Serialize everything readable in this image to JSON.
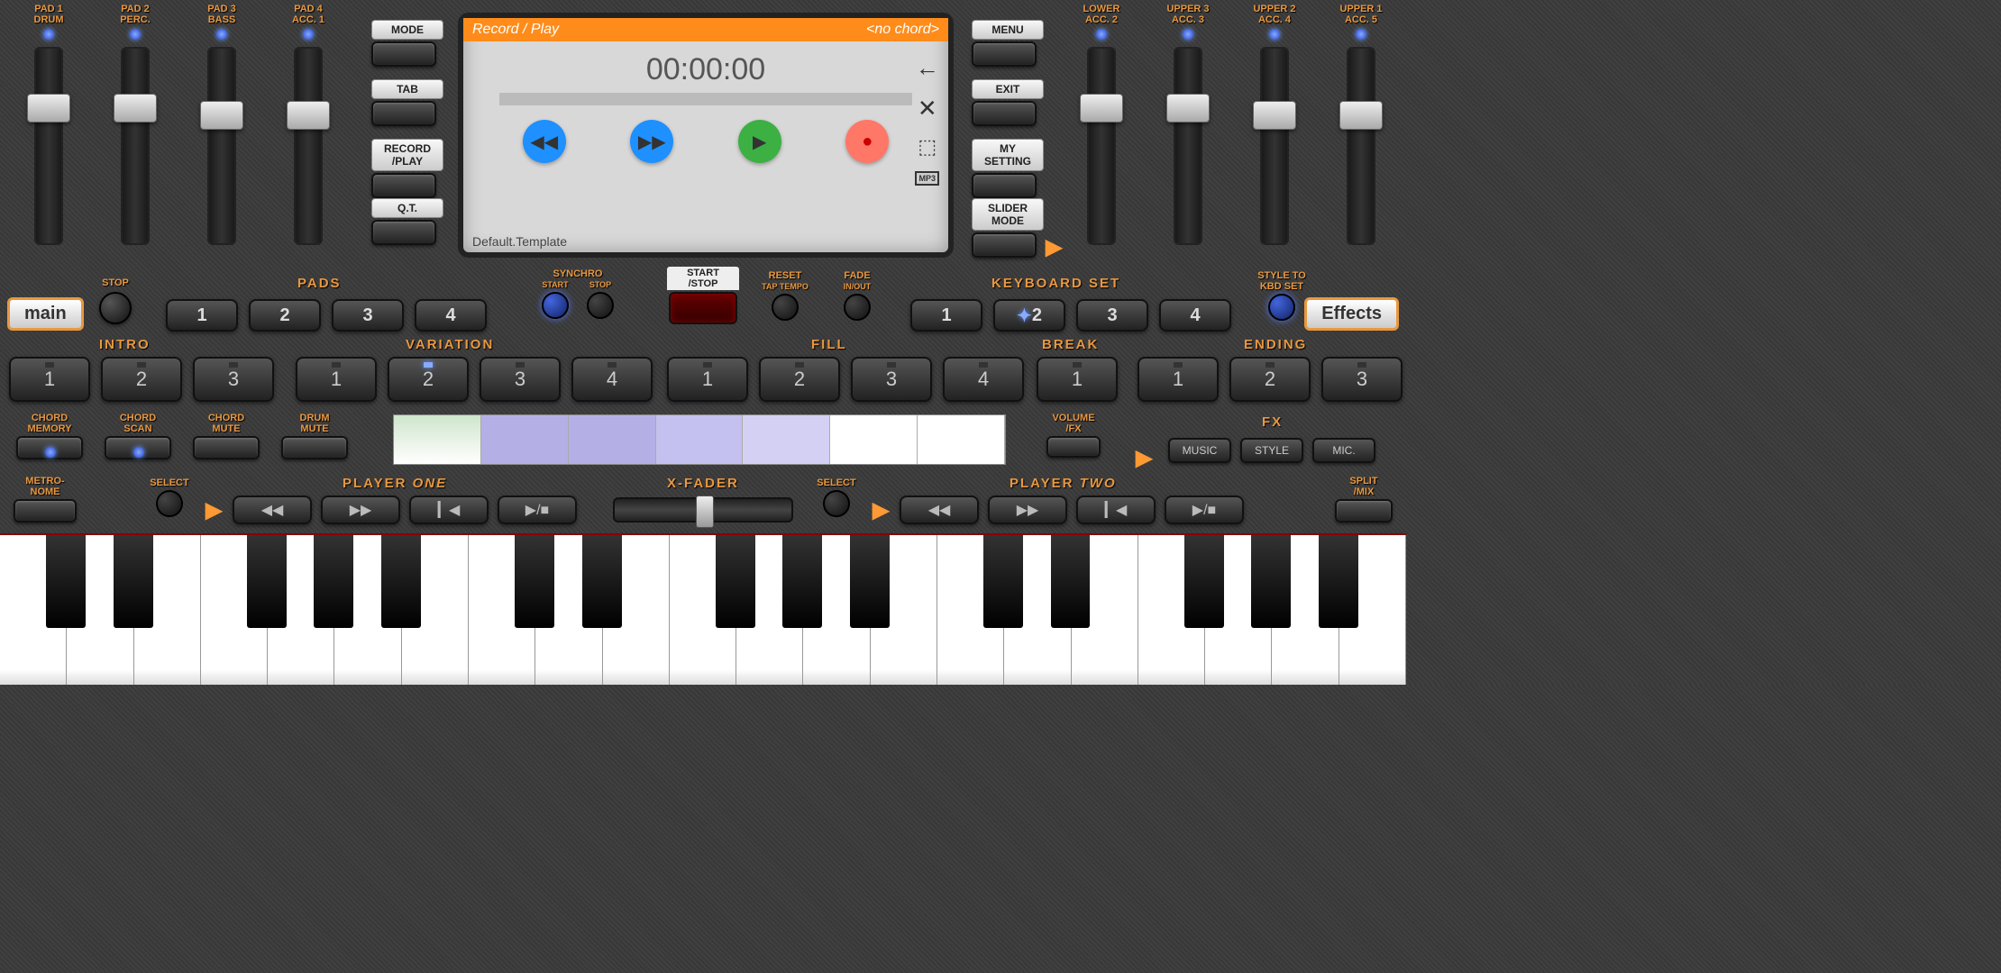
{
  "left_faders": [
    {
      "l1": "PAD 1",
      "l2": "DRUM"
    },
    {
      "l1": "PAD 2",
      "l2": "PERC."
    },
    {
      "l1": "PAD 3",
      "l2": "BASS"
    },
    {
      "l1": "PAD 4",
      "l2": "ACC. 1"
    }
  ],
  "right_faders": [
    {
      "l1": "LOWER",
      "l2": "ACC. 2"
    },
    {
      "l1": "UPPER 3",
      "l2": "ACC. 3"
    },
    {
      "l1": "UPPER 2",
      "l2": "ACC. 4"
    },
    {
      "l1": "UPPER 1",
      "l2": "ACC. 5"
    }
  ],
  "side_left": [
    {
      "t": "MODE"
    },
    {
      "t": "TAB"
    },
    {
      "t": "RECORD\n/PLAY"
    },
    {
      "t": "Q.T."
    }
  ],
  "side_right": [
    {
      "t": "MENU"
    },
    {
      "t": "EXIT"
    },
    {
      "t": "MY\nSETTING"
    },
    {
      "t": "SLIDER\nMODE"
    }
  ],
  "screen": {
    "title": "Record / Play",
    "chord": "<no chord>",
    "time": "00:00:00",
    "template": "Default.Template",
    "mp3": "MP3"
  },
  "main": "main",
  "effects": "Effects",
  "stop": "STOP",
  "pads_lbl": "PADS",
  "pads": [
    "1",
    "2",
    "3",
    "4"
  ],
  "synchro": {
    "lbl": "SYNCHRO",
    "a": "START",
    "b": "STOP"
  },
  "startstop": {
    "a": "START",
    "b": "/STOP"
  },
  "reset": {
    "a": "RESET",
    "b": "TAP TEMPO"
  },
  "fade": {
    "a": "FADE",
    "b": "IN/OUT"
  },
  "kbdset": {
    "lbl": "KEYBOARD SET",
    "nums": [
      "1",
      "2",
      "3",
      "4"
    ]
  },
  "styleto": {
    "a": "STYLE TO",
    "b": "KBD SET"
  },
  "sect": {
    "intro": "INTRO",
    "variation": "VARIATION",
    "fill": "FILL",
    "break": "BREAK",
    "ending": "ENDING"
  },
  "intro": [
    "1",
    "2",
    "3"
  ],
  "variation": [
    "1",
    "2",
    "3",
    "4"
  ],
  "fill": [
    "1",
    "2",
    "3",
    "4"
  ],
  "break": "1",
  "ending": [
    "1",
    "2",
    "3"
  ],
  "chord": {
    "mem": "CHORD\nMEMORY",
    "scan": "CHORD\nSCAN",
    "mute": "CHORD\nMUTE",
    "drum": "DRUM\nMUTE"
  },
  "volfx": "VOLUME\n/FX",
  "fx_lbl": "FX",
  "fx": [
    "MUSIC",
    "STYLE",
    "MIC."
  ],
  "metro": "METRO-\nNOME",
  "select": "SELECT",
  "p1": "PLAYER ",
  "p1b": "ONE",
  "p2": "PLAYER ",
  "p2b": "TWO",
  "xfader": "X-FADER",
  "split": "SPLIT\n/MIX"
}
